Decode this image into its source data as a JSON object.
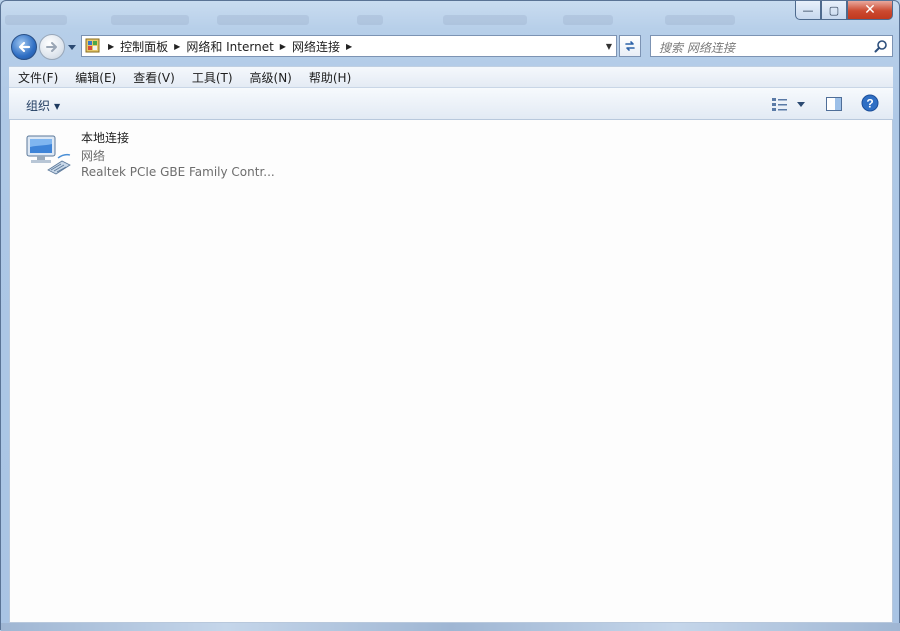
{
  "window": {
    "controls": {
      "minimize": "—",
      "maximize": "▢",
      "close": "✕"
    }
  },
  "navigation": {
    "breadcrumbs": [
      "控制面板",
      "网络和 Internet",
      "网络连接"
    ],
    "search_placeholder": "搜索 网络连接"
  },
  "menubar": {
    "items": [
      "文件(F)",
      "编辑(E)",
      "查看(V)",
      "工具(T)",
      "高级(N)",
      "帮助(H)"
    ]
  },
  "commandbar": {
    "organize_label": "组织"
  },
  "connections": [
    {
      "name": "本地连接",
      "status": "网络",
      "device": "Realtek PCIe GBE Family Contr..."
    }
  ],
  "icons": {
    "back": "back-arrow-icon",
    "forward": "forward-arrow-icon",
    "address": "control-panel-icon",
    "refresh": "refresh-icon",
    "search": "search-icon",
    "views": "views-icon",
    "preview_pane": "preview-pane-icon",
    "help": "help-icon",
    "connection": "network-adapter-icon"
  },
  "colors": {
    "accent": "#2f6fc4",
    "close": "#cc4a30",
    "content_bg": "#fdfdfd",
    "secondary_text": "#6d6d6d"
  }
}
